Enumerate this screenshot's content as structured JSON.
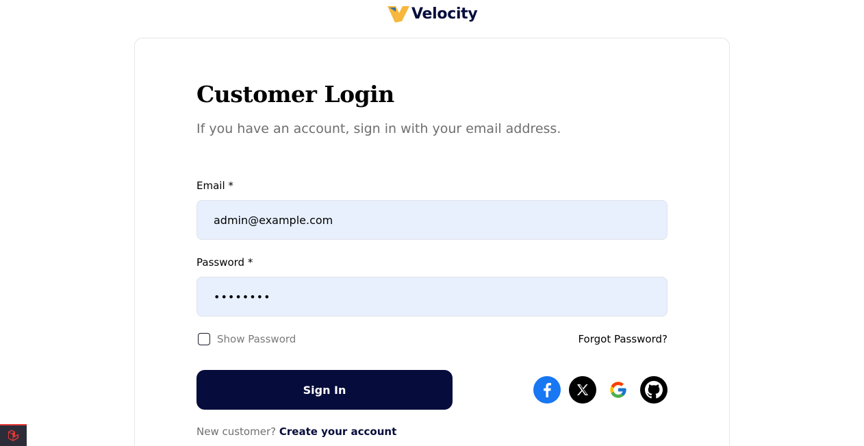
{
  "brand": {
    "name": "Velocity"
  },
  "login": {
    "title": "Customer Login",
    "subtitle": "If you have an account, sign in with your email address.",
    "email_label": "Email *",
    "email_value": "admin@example.com",
    "password_label": "Password *",
    "password_value": "••••••••",
    "show_password_label": "Show Password",
    "forgot_password_label": "Forgot Password?",
    "sign_in_label": "Sign In",
    "new_customer_text": "New customer?",
    "create_account_label": "Create your account"
  },
  "social_logins": [
    {
      "icon": "facebook-icon",
      "color": "#1877f2"
    },
    {
      "icon": "x-twitter-icon",
      "color": "#000000"
    },
    {
      "icon": "google-icon",
      "color": "#ffffff"
    },
    {
      "icon": "github-icon",
      "color": "#000000"
    }
  ],
  "colors": {
    "primary": "#060c3b",
    "input_bg": "#e8f0fe",
    "debug_bar_accent": "#e53935"
  },
  "debug_bar": {
    "icon": "laravel-icon"
  }
}
